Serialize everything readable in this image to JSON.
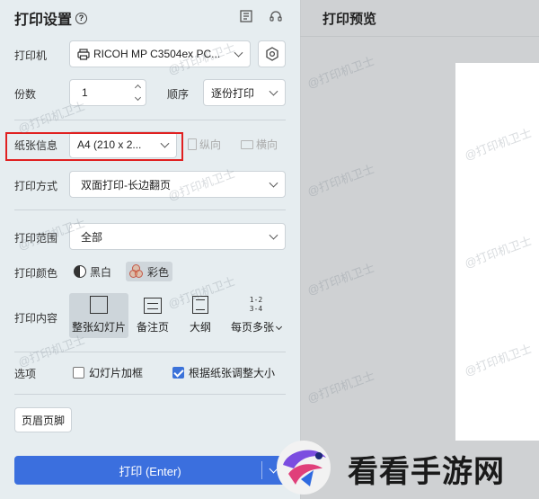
{
  "settings": {
    "title": "打印设置",
    "help_icon": "?",
    "printer": {
      "label": "打印机",
      "value": "RICOH MP C3504ex PC..."
    },
    "copies": {
      "label": "份数",
      "value": "1"
    },
    "order": {
      "label": "顺序",
      "value": "逐份打印"
    },
    "paper": {
      "label": "纸张信息",
      "value": "A4 (210 x 2...",
      "portrait": "纵向",
      "landscape": "横向"
    },
    "print_mode": {
      "label": "打印方式",
      "value": "双面打印-长边翻页"
    },
    "range": {
      "label": "打印范围",
      "value": "全部"
    },
    "color": {
      "label": "打印颜色",
      "bw": "黑白",
      "color": "彩色",
      "selected": "彩色"
    },
    "content": {
      "label": "打印内容",
      "options": [
        "整张幻灯片",
        "备注页",
        "大纲",
        "每页多张"
      ],
      "selected": "整张幻灯片",
      "multi_glyph": [
        "1-2",
        "3-4"
      ]
    },
    "options": {
      "label": "选项",
      "frame": "幻灯片加框",
      "fit": "根据纸张调整大小"
    },
    "header_footer": "页眉页脚",
    "print_button": "打印 (Enter)"
  },
  "preview": {
    "title": "打印预览"
  },
  "watermark": "@打印机卫士",
  "brand": {
    "text": "看看手游网"
  },
  "icons": [
    "help-icon",
    "layout-icon",
    "headset-icon",
    "printer-icon",
    "gear-icon",
    "portrait-page-icon",
    "landscape-page-icon",
    "bw-icon",
    "color-icon"
  ],
  "colors": {
    "accent": "#3b6fde",
    "highlight_box": "#e02020"
  }
}
